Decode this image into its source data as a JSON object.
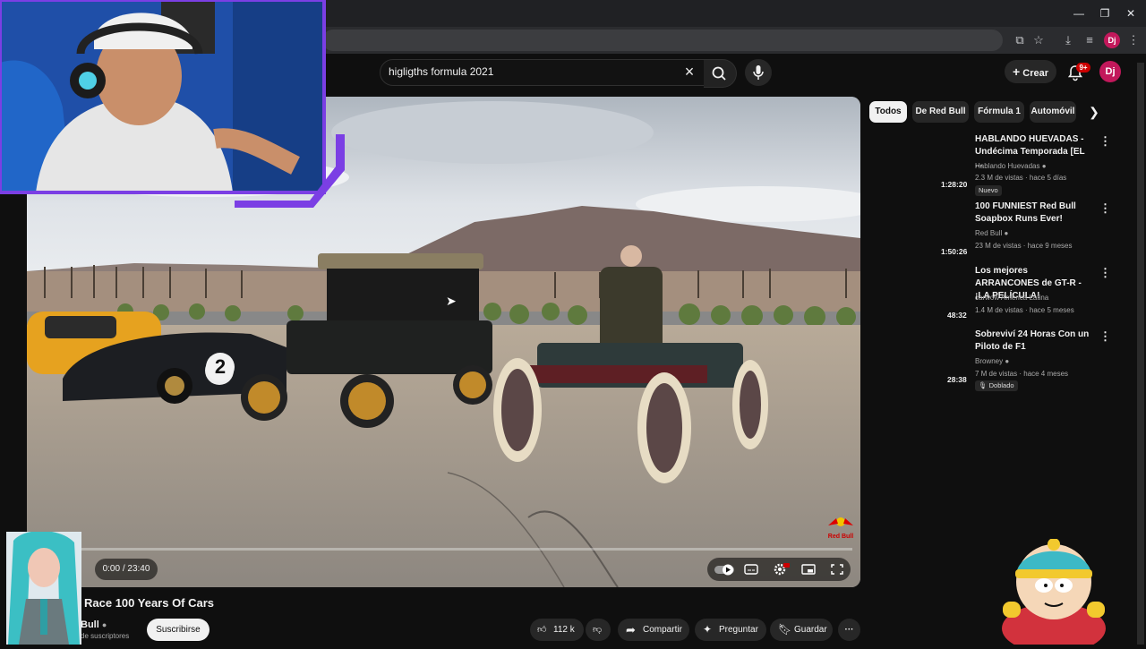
{
  "search": {
    "query": "higligths formula 2021"
  },
  "header": {
    "create_label": "Crear",
    "notif_count": "9+",
    "avatar_initials": "Dj",
    "profile_initials": "Dj"
  },
  "player": {
    "time": "0:00 / 23:40",
    "watermark": "Red Bull",
    "car_number": "2"
  },
  "video": {
    "title": "Race 100 Years Of Cars",
    "channel": "Bull",
    "subscribers": "de suscriptores",
    "subscribe_label": "Suscribirse",
    "likes": "112 k",
    "share_label": "Compartir",
    "ask_label": "Preguntar",
    "save_label": "Guardar"
  },
  "chips": [
    "Todos",
    "De Red Bull",
    "Fórmula 1",
    "Automóvil"
  ],
  "recommendations": [
    {
      "title": "HABLANDO HUEVADAS - Undécima Temporada [EL ...",
      "channel": "Hablando Huevadas",
      "meta": "2.3 M de vistas · hace 5 días",
      "duration": "1:28:20",
      "badge": "Nuevo"
    },
    {
      "title": "100 FUNNIEST Red Bull Soapbox Runs Ever!",
      "channel": "Red Bull",
      "meta": "23 M de vistas · hace 9 meses",
      "duration": "1:50:26",
      "badge": ""
    },
    {
      "title": "Los mejores ARRANCONES de GT-R - ¡LA PELÍCULA!",
      "channel": "carwow América Latina",
      "meta": "1.4 M de vistas · hace 5 meses",
      "duration": "48:32",
      "badge": ""
    },
    {
      "title": "Sobreviví 24 Horas Con un Piloto de F1",
      "channel": "Browney",
      "meta": "7 M de vistas · hace 4 meses",
      "duration": "28:38",
      "badge": "Doblado"
    }
  ],
  "colors": {
    "accent": "#cc0000",
    "overlay_purple": "#7b3fe4",
    "avatar": "#c2185b",
    "background": "#0f0f0f"
  }
}
